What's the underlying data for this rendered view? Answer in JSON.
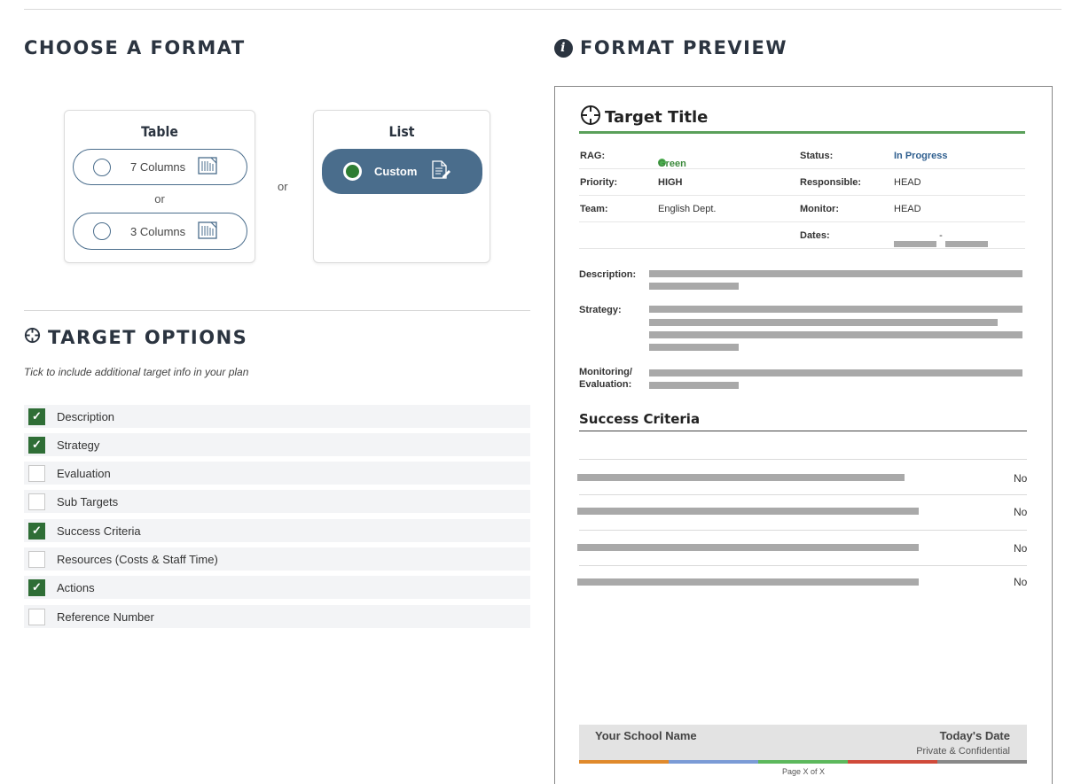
{
  "choose_format": {
    "heading": "CHOOSE A FORMAT",
    "table_card": {
      "title": "Table",
      "option1": "7 Columns",
      "or_label": "or",
      "option2": "3 Columns"
    },
    "between_or": "or",
    "list_card": {
      "title": "List",
      "option": "Custom",
      "selected": true
    }
  },
  "target_options": {
    "heading": "TARGET OPTIONS",
    "subtitle": "Tick to include additional target info in your plan",
    "items": [
      {
        "label": "Description",
        "checked": true
      },
      {
        "label": "Strategy",
        "checked": true
      },
      {
        "label": "Evaluation",
        "checked": false
      },
      {
        "label": "Sub Targets",
        "checked": false
      },
      {
        "label": "Success Criteria",
        "checked": true
      },
      {
        "label": "Resources (Costs & Staff Time)",
        "checked": false
      },
      {
        "label": "Actions",
        "checked": true
      },
      {
        "label": "Reference Number",
        "checked": false
      }
    ]
  },
  "preview": {
    "heading": "FORMAT PREVIEW",
    "target_title": "Target Title",
    "rows": [
      {
        "l1": "RAG:",
        "v1": "Green",
        "l2": "Status:",
        "v2": "In Progress"
      },
      {
        "l1": "Priority:",
        "v1": "HIGH",
        "l2": "Responsible:",
        "v2": "HEAD"
      },
      {
        "l1": "Team:",
        "v1": "English Dept.",
        "l2": "Monitor:",
        "v2": "HEAD"
      },
      {
        "l1": "",
        "v1": "",
        "l2": "Dates:",
        "v2": ""
      }
    ],
    "dates_separator": "-",
    "description_label": "Description:",
    "strategy_label": "Strategy:",
    "monitoring_label_1": "Monitoring/",
    "monitoring_label_2": "Evaluation:",
    "success_criteria_title": "Success Criteria",
    "criteria_values": [
      "No",
      "No",
      "No",
      "No"
    ],
    "footer": {
      "school": "Your School Name",
      "date": "Today's Date",
      "private": "Private & Confidential",
      "page": "Page X of X"
    }
  },
  "colors": {
    "accent_blue": "#4a6d8c",
    "check_green": "#2f6e36",
    "rag_green": "#4caf50",
    "footer_stripes": [
      "#e08a2c",
      "#7b9bd6",
      "#5cb85c",
      "#d04a3a",
      "#888888"
    ]
  }
}
